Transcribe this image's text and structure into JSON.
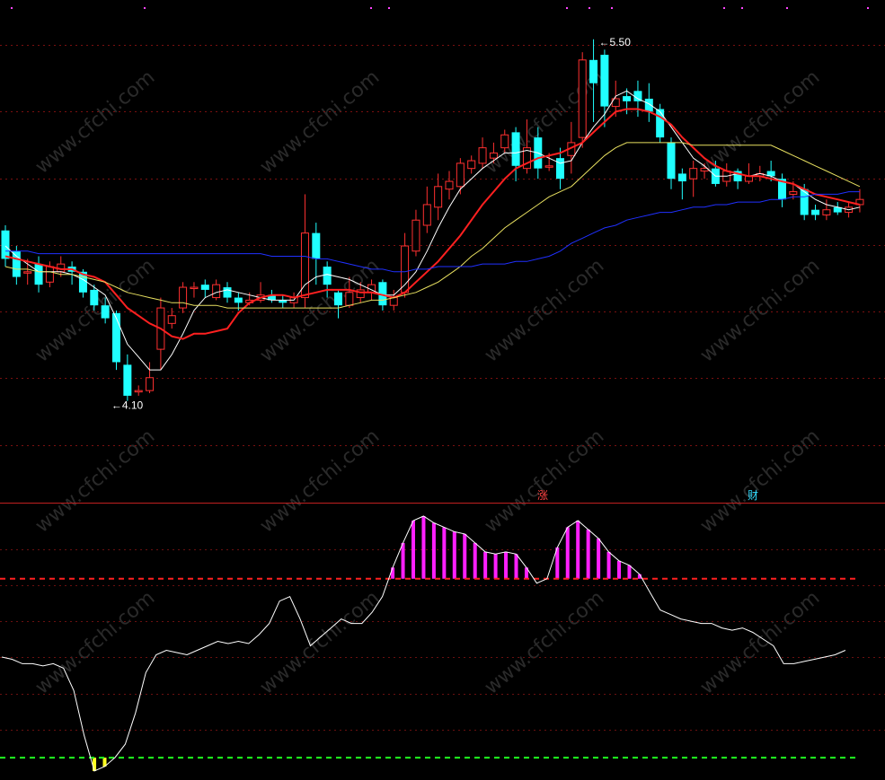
{
  "chart_data": [
    {
      "type": "candlestick",
      "panel": "price",
      "ylim": [
        3.8,
        5.6
      ],
      "annotations": {
        "high_label": "5.50",
        "low_label": "4.10",
        "high_arrow": "←",
        "low_arrow": "←"
      },
      "markers": [
        {
          "text": "涨",
          "color": "#ff4444"
        },
        {
          "text": "财",
          "color": "#33ddff"
        }
      ],
      "candles": [
        [
          4.76,
          4.65,
          4.78,
          4.62
        ],
        [
          4.68,
          4.58,
          4.7,
          4.55
        ],
        [
          4.6,
          4.6,
          4.65,
          4.55
        ],
        [
          4.63,
          4.55,
          4.66,
          4.52
        ],
        [
          4.56,
          4.62,
          4.64,
          4.54
        ],
        [
          4.6,
          4.63,
          4.66,
          4.58
        ],
        [
          4.62,
          4.6,
          4.64,
          4.55
        ],
        [
          4.6,
          4.52,
          4.61,
          4.5
        ],
        [
          4.53,
          4.47,
          4.55,
          4.45
        ],
        [
          4.47,
          4.42,
          4.5,
          4.4
        ],
        [
          4.44,
          4.25,
          4.45,
          4.22
        ],
        [
          4.24,
          4.12,
          4.28,
          4.1
        ],
        [
          4.14,
          4.14,
          4.16,
          4.12
        ],
        [
          4.14,
          4.19,
          4.25,
          4.13
        ],
        [
          4.3,
          4.46,
          4.5,
          4.22
        ],
        [
          4.4,
          4.43,
          4.46,
          4.38
        ],
        [
          4.46,
          4.54,
          4.56,
          4.44
        ],
        [
          4.54,
          4.54,
          4.56,
          4.5
        ],
        [
          4.55,
          4.53,
          4.57,
          4.5
        ],
        [
          4.5,
          4.55,
          4.57,
          4.49
        ],
        [
          4.54,
          4.5,
          4.56,
          4.48
        ],
        [
          4.5,
          4.48,
          4.52,
          4.45
        ],
        [
          4.48,
          4.49,
          4.52,
          4.47
        ],
        [
          4.49,
          4.51,
          4.56,
          4.48
        ],
        [
          4.51,
          4.49,
          4.53,
          4.48
        ],
        [
          4.49,
          4.48,
          4.51,
          4.46
        ],
        [
          4.48,
          4.5,
          4.52,
          4.46
        ],
        [
          4.5,
          4.75,
          4.9,
          4.46
        ],
        [
          4.75,
          4.65,
          4.79,
          4.55
        ],
        [
          4.62,
          4.55,
          4.64,
          4.5
        ],
        [
          4.52,
          4.47,
          4.53,
          4.42
        ],
        [
          4.47,
          4.52,
          4.58,
          4.46
        ],
        [
          4.5,
          4.53,
          4.56,
          4.48
        ],
        [
          4.52,
          4.55,
          4.57,
          4.49
        ],
        [
          4.56,
          4.47,
          4.57,
          4.45
        ],
        [
          4.47,
          4.5,
          4.53,
          4.45
        ],
        [
          4.52,
          4.7,
          4.75,
          4.5
        ],
        [
          4.68,
          4.8,
          4.84,
          4.66
        ],
        [
          4.78,
          4.86,
          4.93,
          4.75
        ],
        [
          4.85,
          4.93,
          4.98,
          4.8
        ],
        [
          4.92,
          4.95,
          4.99,
          4.88
        ],
        [
          4.93,
          5.02,
          5.04,
          4.9
        ],
        [
          5.0,
          5.03,
          5.05,
          4.98
        ],
        [
          5.02,
          5.08,
          5.12,
          5.0
        ],
        [
          5.04,
          5.06,
          5.1,
          5.02
        ],
        [
          5.08,
          5.13,
          5.15,
          5.06
        ],
        [
          5.14,
          5.01,
          5.16,
          4.95
        ],
        [
          5.0,
          5.08,
          5.19,
          4.98
        ],
        [
          5.12,
          5.0,
          5.16,
          4.96
        ],
        [
          5.01,
          5.01,
          5.06,
          4.99
        ],
        [
          5.04,
          4.96,
          5.08,
          4.92
        ],
        [
          5.05,
          5.1,
          5.18,
          4.98
        ],
        [
          5.12,
          5.42,
          5.45,
          5.08
        ],
        [
          5.42,
          5.33,
          5.5,
          5.18
        ],
        [
          5.44,
          5.24,
          5.46,
          5.16
        ],
        [
          5.24,
          5.27,
          5.34,
          5.2
        ],
        [
          5.28,
          5.26,
          5.31,
          5.21
        ],
        [
          5.3,
          5.26,
          5.34,
          5.2
        ],
        [
          5.27,
          5.22,
          5.33,
          5.18
        ],
        [
          5.23,
          5.12,
          5.25,
          5.1
        ],
        [
          5.1,
          4.96,
          5.12,
          4.92
        ],
        [
          4.98,
          4.95,
          5.0,
          4.88
        ],
        [
          4.96,
          5.0,
          5.03,
          4.89
        ],
        [
          4.99,
          5.0,
          5.02,
          4.96
        ],
        [
          5.0,
          4.94,
          5.03,
          4.93
        ],
        [
          4.95,
          4.99,
          5.02,
          4.93
        ],
        [
          4.99,
          4.95,
          5.0,
          4.92
        ],
        [
          4.95,
          4.97,
          5.02,
          4.94
        ],
        [
          4.97,
          4.98,
          5.01,
          4.95
        ],
        [
          4.99,
          4.97,
          5.03,
          4.95
        ],
        [
          4.96,
          4.88,
          4.98,
          4.85
        ],
        [
          4.9,
          4.91,
          4.95,
          4.88
        ],
        [
          4.92,
          4.82,
          4.94,
          4.8
        ],
        [
          4.84,
          4.82,
          4.86,
          4.8
        ],
        [
          4.82,
          4.84,
          4.88,
          4.8
        ],
        [
          4.85,
          4.83,
          4.87,
          4.82
        ],
        [
          4.83,
          4.85,
          4.87,
          4.81
        ],
        [
          4.86,
          4.88,
          4.92,
          4.83
        ]
      ],
      "series": [
        {
          "name": "MA5",
          "color": "#ffffff",
          "values": [
            4.7,
            4.66,
            4.63,
            4.6,
            4.6,
            4.6,
            4.59,
            4.57,
            4.54,
            4.51,
            4.42,
            4.32,
            4.27,
            4.22,
            4.22,
            4.28,
            4.36,
            4.45,
            4.5,
            4.52,
            4.53,
            4.52,
            4.51,
            4.5,
            4.49,
            4.49,
            4.49,
            4.55,
            4.58,
            4.59,
            4.58,
            4.57,
            4.55,
            4.53,
            4.51,
            4.51,
            4.55,
            4.6,
            4.68,
            4.77,
            4.85,
            4.92,
            4.96,
            5.0,
            5.03,
            5.06,
            5.06,
            5.07,
            5.06,
            5.04,
            5.02,
            5.03,
            5.1,
            5.16,
            5.21,
            5.28,
            5.3,
            5.27,
            5.25,
            5.22,
            5.16,
            5.1,
            5.04,
            5.01,
            4.97,
            4.97,
            4.98,
            4.97,
            4.98,
            4.97,
            4.95,
            4.94,
            4.91,
            4.88,
            4.86,
            4.85,
            4.84,
            4.85
          ]
        },
        {
          "name": "MA10",
          "color": "#ff2020",
          "values": [
            4.66,
            4.65,
            4.64,
            4.63,
            4.62,
            4.61,
            4.61,
            4.59,
            4.58,
            4.56,
            4.51,
            4.46,
            4.43,
            4.4,
            4.38,
            4.35,
            4.34,
            4.36,
            4.36,
            4.37,
            4.38,
            4.44,
            4.48,
            4.5,
            4.51,
            4.51,
            4.5,
            4.51,
            4.52,
            4.53,
            4.53,
            4.53,
            4.52,
            4.52,
            4.51,
            4.5,
            4.52,
            4.56,
            4.6,
            4.64,
            4.69,
            4.74,
            4.8,
            4.86,
            4.91,
            4.96,
            5.0,
            5.02,
            5.04,
            5.05,
            5.06,
            5.08,
            5.1,
            5.14,
            5.18,
            5.22,
            5.23,
            5.23,
            5.22,
            5.2,
            5.17,
            5.12,
            5.08,
            5.04,
            5.01,
            4.99,
            4.98,
            4.97,
            4.97,
            4.96,
            4.95,
            4.94,
            4.92,
            4.9,
            4.89,
            4.88,
            4.87,
            4.86
          ]
        },
        {
          "name": "MA20",
          "color": "#e8e060",
          "values": [
            4.62,
            4.61,
            4.61,
            4.6,
            4.6,
            4.59,
            4.59,
            4.58,
            4.57,
            4.56,
            4.54,
            4.52,
            4.51,
            4.5,
            4.49,
            4.48,
            4.48,
            4.47,
            4.47,
            4.47,
            4.46,
            4.46,
            4.46,
            4.46,
            4.46,
            4.46,
            4.46,
            4.46,
            4.46,
            4.46,
            4.46,
            4.47,
            4.48,
            4.49,
            4.49,
            4.5,
            4.51,
            4.52,
            4.54,
            4.56,
            4.59,
            4.62,
            4.66,
            4.69,
            4.73,
            4.77,
            4.8,
            4.83,
            4.86,
            4.89,
            4.91,
            4.93,
            4.97,
            5.01,
            5.05,
            5.08,
            5.1,
            5.1,
            5.1,
            5.1,
            5.1,
            5.1,
            5.09,
            5.09,
            5.09,
            5.09,
            5.09,
            5.09,
            5.09,
            5.09,
            5.07,
            5.05,
            5.03,
            5.01,
            4.99,
            4.97,
            4.95,
            4.93
          ]
        },
        {
          "name": "MA60",
          "color": "#2030ff",
          "values": [
            4.68,
            4.68,
            4.68,
            4.67,
            4.67,
            4.67,
            4.67,
            4.67,
            4.67,
            4.67,
            4.67,
            4.67,
            4.67,
            4.67,
            4.67,
            4.67,
            4.67,
            4.67,
            4.67,
            4.67,
            4.67,
            4.67,
            4.67,
            4.67,
            4.66,
            4.66,
            4.66,
            4.66,
            4.65,
            4.65,
            4.64,
            4.63,
            4.62,
            4.61,
            4.61,
            4.6,
            4.6,
            4.61,
            4.61,
            4.62,
            4.62,
            4.62,
            4.62,
            4.63,
            4.63,
            4.63,
            4.64,
            4.64,
            4.65,
            4.66,
            4.68,
            4.71,
            4.73,
            4.75,
            4.77,
            4.78,
            4.8,
            4.81,
            4.82,
            4.83,
            4.83,
            4.84,
            4.85,
            4.85,
            4.86,
            4.86,
            4.87,
            4.87,
            4.87,
            4.88,
            4.88,
            4.89,
            4.89,
            4.9,
            4.9,
            4.9,
            4.91,
            4.91
          ]
        }
      ]
    },
    {
      "type": "line",
      "panel": "indicator",
      "ylim": [
        -10,
        110
      ],
      "upper_threshold": 80,
      "lower_threshold": 0,
      "colors": {
        "line": "#ffffff",
        "upper_bars": "#ff20ff",
        "lower_bars": "#ffff20",
        "upper_dash": "#ff2020",
        "lower_dash": "#20ff20"
      },
      "series": [
        {
          "name": "indicator",
          "values": [
            45,
            44,
            42,
            42,
            41,
            42,
            40,
            30,
            10,
            -6,
            -4,
            0,
            6,
            20,
            38,
            46,
            48,
            47,
            46,
            48,
            50,
            52,
            51,
            52,
            51,
            55,
            60,
            70,
            72,
            62,
            50,
            54,
            58,
            62,
            60,
            60,
            65,
            72,
            85,
            96,
            106,
            108,
            105,
            103,
            101,
            100,
            96,
            92,
            91,
            92,
            91,
            85,
            78,
            80,
            94,
            103,
            106,
            102,
            98,
            92,
            88,
            86,
            82,
            74,
            66,
            64,
            62,
            61,
            60,
            60,
            58,
            57,
            58,
            56,
            53,
            50,
            42,
            42,
            43,
            44,
            45,
            46,
            48
          ]
        }
      ]
    }
  ]
}
